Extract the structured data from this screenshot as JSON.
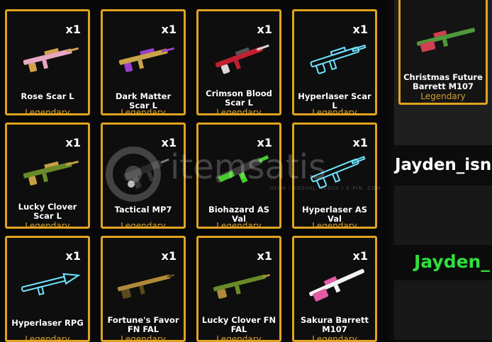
{
  "cards": [
    {
      "qty": "x1",
      "name": "Rose Scar L",
      "rarity": "Legendary",
      "color": "#e8a6c4",
      "accent": "#d4a24a"
    },
    {
      "qty": "x1",
      "name": "Dark Matter Scar L",
      "rarity": "Legendary",
      "color": "#c9a54a",
      "accent": "#9b3fd1"
    },
    {
      "qty": "x1",
      "name": "Crimson Blood Scar L",
      "rarity": "Legendary",
      "color": "#c02030",
      "accent": "#d8d8d8"
    },
    {
      "qty": "x1",
      "name": "Hyperlaser Scar L",
      "rarity": "Legendary",
      "color": "#6fe3ff",
      "accent": "#1a2a33"
    },
    {
      "qty": "x1",
      "name": "Lucky Clover Scar L",
      "rarity": "Legendary",
      "color": "#6a8a2a",
      "accent": "#c6a043"
    },
    {
      "qty": "x1",
      "name": "Tactical MP7",
      "rarity": "Legendary",
      "color": "#2a2a2a",
      "accent": "#777777"
    },
    {
      "qty": "x1",
      "name": "Biohazard AS Val",
      "rarity": "Legendary",
      "color": "#46cc2d",
      "accent": "#3a3a3a"
    },
    {
      "qty": "x1",
      "name": "Hyperlaser AS Val",
      "rarity": "Legendary",
      "color": "#6fe3ff",
      "accent": "#1a2a33"
    },
    {
      "qty": "x1",
      "name": "Hyperlaser RPG",
      "rarity": "Legendary",
      "color": "#6fe3ff",
      "accent": "#1a2a33"
    },
    {
      "qty": "x1",
      "name": "Fortune's Favor FN FAL",
      "rarity": "Legendary",
      "color": "#b08a3a",
      "accent": "#5a4a1c"
    },
    {
      "qty": "x1",
      "name": "Lucky Clover FN FAL",
      "rarity": "Legendary",
      "color": "#6a8a2a",
      "accent": "#b08a3a"
    },
    {
      "qty": "x1",
      "name": "Sakura Barrett M107",
      "rarity": "Legendary",
      "color": "#f2f2f2",
      "accent": "#e45aa5"
    }
  ],
  "side": {
    "card": {
      "name": "Christmas Future Barrett M107",
      "rarity": "Legendary",
      "color": "#4e9a3a",
      "accent": "#d04050"
    },
    "username": "Jayden_isn",
    "username_green": "Jayden_"
  },
  "watermark": {
    "text": "itemsatis",
    "sub": "OYUN / SOSYAL MEDYA / E-PIN .COM"
  }
}
